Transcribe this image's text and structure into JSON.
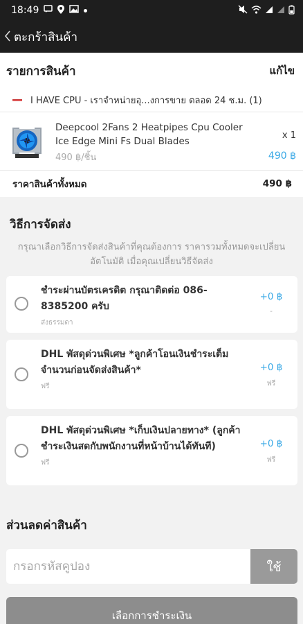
{
  "status_bar": {
    "time": "18:49"
  },
  "app_bar": {
    "title": "ตะกร้าสินค้า"
  },
  "items_section": {
    "title": "รายการสินค้า",
    "edit_label": "แก้ไข",
    "shop_name": "I HAVE CPU - เราจำหน่ายอุ...งการขาย ตลอด 24 ช.ม. (1)",
    "product": {
      "name": "Deepcool 2Fans 2 Heatpipes Cpu Cooler Ice Edge Mini Fs Dual Blades",
      "unit_price": "490  ฿/ชิ้น",
      "qty": "x 1",
      "price": "490 ฿"
    },
    "total_label": "ราคาสินค้าทั้งหมด",
    "total_value": "490 ฿"
  },
  "shipping": {
    "title": "วิธีการจัดส่ง",
    "hint": "กรุณาเลือกวิธีการจัดส่งสินค้าที่คุณต้องการ ราคารวมทั้งหมดจะเปลี่ยนอัตโนมัติ เมื่อคุณเปลี่ยนวิธีจัดส่ง",
    "options": [
      {
        "name": "ชำระผ่านบัตรเครดิต กรุณาติดต่อ 086-8385200 ครับ",
        "sub": "ส่งธรรมดา",
        "price": "+0 ฿",
        "note": "-"
      },
      {
        "name": "DHL พัสดุด่วนพิเศษ *ลูกค้าโอนเงินชำระเต็มจำนวนก่อนจัดส่งสินค้า*",
        "sub": "ฟรี",
        "price": "+0 ฿",
        "note": "ฟรี"
      },
      {
        "name": "DHL พัสดุด่วนพิเศษ *เก็บเงินปลายทาง* (ลูกค้าชำระเงินสดกับพนักงานที่หน้าบ้านได้ทันที)",
        "sub": "ฟรี",
        "price": "+0 ฿",
        "note": "ฟรี"
      }
    ]
  },
  "discount": {
    "title": "ส่วนลดค่าสินค้า",
    "placeholder": "กรอกรหัสคูปอง",
    "apply_label": "ใช้"
  },
  "bottom_button": {
    "label": "เลือกการชำระเงิน"
  },
  "colors": {
    "accent": "#3aa9e6",
    "header": "#1e1e1e",
    "button": "#8d8d8d"
  }
}
